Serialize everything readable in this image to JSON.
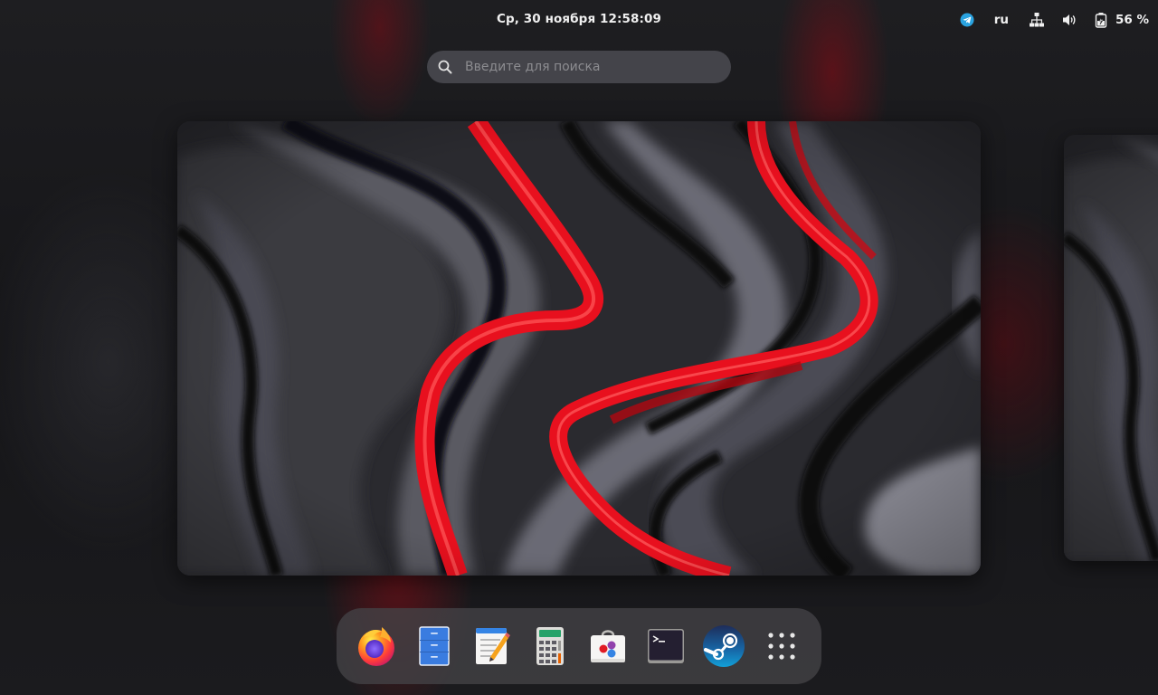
{
  "topbar": {
    "clock": "Ср, 30 ноября  12:58:09",
    "tray": {
      "telegram_icon": "telegram-icon",
      "language": "ru",
      "network_icon": "wired-network-icon",
      "volume_icon": "volume-icon",
      "battery_icon": "battery-charging-icon",
      "battery_percent": "56 %"
    }
  },
  "search": {
    "placeholder": "Введите для поиска",
    "value": ""
  },
  "workspaces": {
    "count_visible": 2,
    "wallpaper": "red-gray-swirl-abstract"
  },
  "dash": {
    "apps": [
      {
        "name": "Firefox",
        "icon": "firefox-icon"
      },
      {
        "name": "Files",
        "icon": "files-icon"
      },
      {
        "name": "Text Editor",
        "icon": "text-editor-icon"
      },
      {
        "name": "Calculator",
        "icon": "calculator-icon"
      },
      {
        "name": "Software",
        "icon": "software-store-icon"
      },
      {
        "name": "Terminal",
        "icon": "terminal-icon"
      },
      {
        "name": "Steam",
        "icon": "steam-icon"
      },
      {
        "name": "Show Applications",
        "icon": "app-grid-icon"
      }
    ]
  },
  "colors": {
    "accent_red": "#e8101e",
    "panel_text": "#f0f0f0",
    "dash_bg": "#444246",
    "search_bg": "#48484e"
  }
}
